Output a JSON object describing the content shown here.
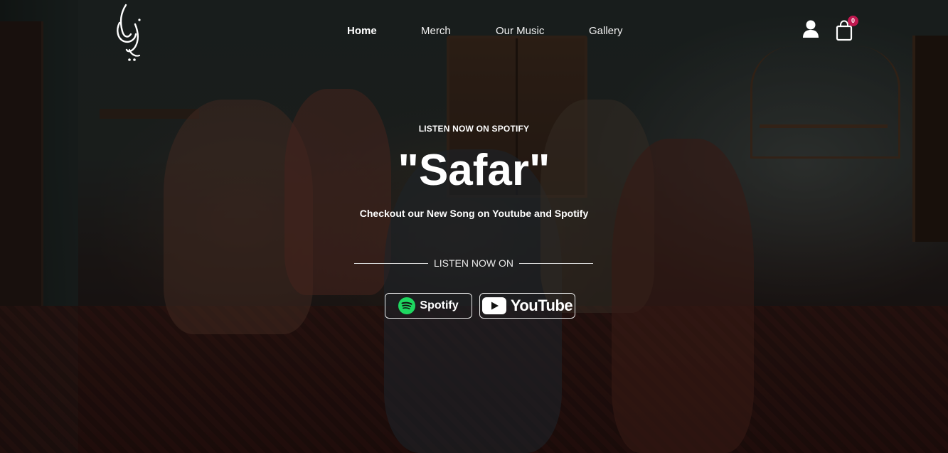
{
  "nav": {
    "home": "Home",
    "merch": "Merch",
    "music": "Our Music",
    "gallery": "Gallery"
  },
  "header": {
    "cart_count": "0",
    "icons": [
      "logo-calligraphy",
      "user-icon",
      "shopping-bag-icon"
    ]
  },
  "hero": {
    "kicker": "LISTEN NOW ON SPOTIFY",
    "title": "\"Safar\"",
    "subtitle": "Checkout our New Song on Youtube and Spotify",
    "listen_on": "LISTEN NOW ON",
    "spotify_label": "Spotify",
    "youtube_label": "YouTube"
  },
  "colors": {
    "badge": "#c0184f",
    "spotify_green": "#1ed760",
    "text": "#ffffff"
  }
}
